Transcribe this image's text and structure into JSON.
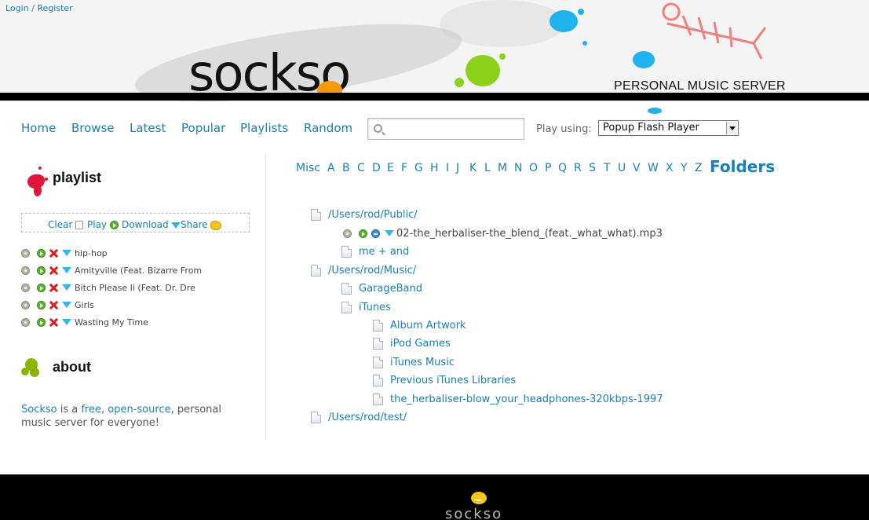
{
  "top_links": {
    "login": "Login",
    "separator": "/",
    "register": "Register"
  },
  "logo": "sockso",
  "tagline": "PERSONAL MUSIC SERVER",
  "nav": [
    "Home",
    "Browse",
    "Latest",
    "Popular",
    "Playlists",
    "Random"
  ],
  "search": {
    "value": "",
    "placeholder": ""
  },
  "player": {
    "label": "Play using:",
    "selected": "Popup Flash Player"
  },
  "playlist": {
    "title": "playlist",
    "toolbar": {
      "clear": "Clear",
      "play": "Play",
      "download": "Download",
      "share": "Share"
    },
    "items": [
      "hip-hop",
      "Amityville (Feat. Bizarre From",
      "Bitch Please Ii (Feat. Dr. Dre",
      "Girls",
      "Wasting My Time"
    ]
  },
  "about": {
    "title": "about",
    "parts": {
      "link1": "Sockso",
      "t1": " is a ",
      "link2": "free",
      "t2": ", ",
      "link3": "open-source",
      "t3": ", personal music server for everyone!"
    }
  },
  "alphabet": [
    "Misc",
    "A",
    "B",
    "C",
    "D",
    "E",
    "F",
    "G",
    "H",
    "I",
    "J",
    "K",
    "L",
    "M",
    "N",
    "O",
    "P",
    "Q",
    "R",
    "S",
    "T",
    "U",
    "V",
    "W",
    "X",
    "Y",
    "Z"
  ],
  "alphabet_active": "Folders",
  "tree": {
    "r1": "/Users/rod/Public/",
    "r1_file": "02-the_herbaliser-the_blend_(feat._what_what).mp3",
    "r1_sub": "me + and",
    "r2": "/Users/rod/Music/",
    "r2_sub1": "GarageBand",
    "r2_sub2": "iTunes",
    "itunes": [
      "Album Artwork",
      "iPod Games",
      "iTunes Music",
      "Previous iTunes Libraries",
      "the_herbaliser-blow_your_headphones-320kbps-1997"
    ],
    "r3": "/Users/rod/test/"
  },
  "footer_logo": "sockso",
  "colors": {
    "link": "#1a7fb5",
    "header_bar": "#000000",
    "footer": "#000000"
  }
}
